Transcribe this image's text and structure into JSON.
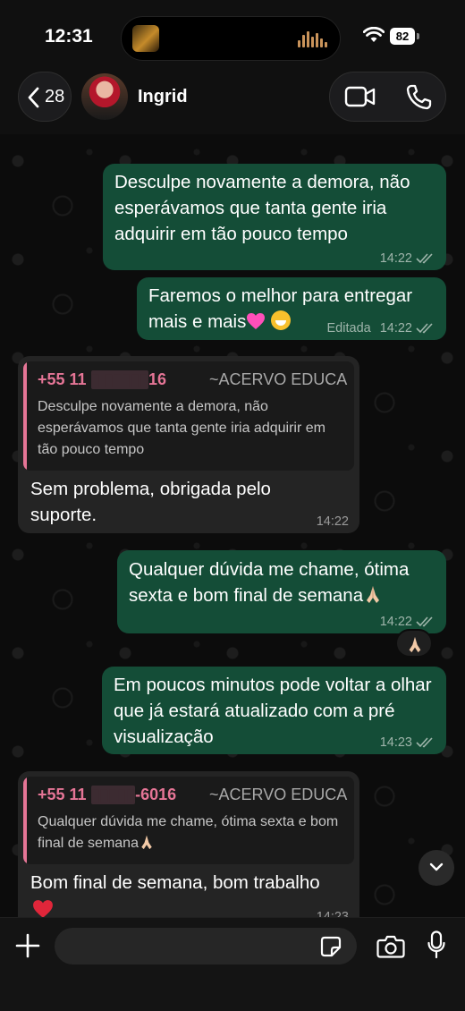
{
  "status_bar": {
    "time": "12:31",
    "battery": "82"
  },
  "header": {
    "back_count": "28",
    "contact_name": "Ingrid"
  },
  "messages": [
    {
      "direction": "outgoing",
      "text": "Desculpe novamente a demora, não esperávamos que tanta gente iria adquirir em tão pouco tempo",
      "time": "14:22",
      "edited": "",
      "status": "read"
    },
    {
      "direction": "outgoing",
      "text": "Faremos o melhor para entregar mais e mais",
      "time": "14:22",
      "edited": "Editada",
      "status": "read",
      "emojis": [
        "pink-heart",
        "grinning-sweat"
      ]
    },
    {
      "direction": "incoming",
      "quote": {
        "sender_prefix": "+55 11",
        "sender_suffix": "16",
        "group": "~ACERVO EDUCA",
        "text": "Desculpe novamente a demora, não esperávamos que tanta gente iria adquirir em tão pouco tempo"
      },
      "text": "Sem problema, obrigada pelo suporte.",
      "time": "14:22"
    },
    {
      "direction": "outgoing",
      "text": "Qualquer dúvida me chame, ótima sexta e bom final de semana",
      "time": "14:22",
      "status": "read",
      "emojis": [
        "folded-hands"
      ],
      "reaction": "folded-hands"
    },
    {
      "direction": "outgoing",
      "text": "Em poucos minutos pode voltar a olhar que já estará atualizado com a pré visualização",
      "time": "14:23",
      "status": "read"
    },
    {
      "direction": "incoming",
      "quote": {
        "sender_prefix": "+55 11",
        "sender_suffix": "-6016",
        "group": "~ACERVO EDUCA",
        "text": "Qualquer dúvida me chame, ótima sexta e bom final de semana"
      },
      "text": "Bom final de semana, bom trabalho",
      "time": "14:23",
      "emojis": [
        "red-heart"
      ]
    }
  ],
  "composer": {
    "placeholder": ""
  },
  "colors": {
    "outgoing_bubble": "#144d37",
    "incoming_bubble": "#242424",
    "quote_accent": "#e57596"
  }
}
